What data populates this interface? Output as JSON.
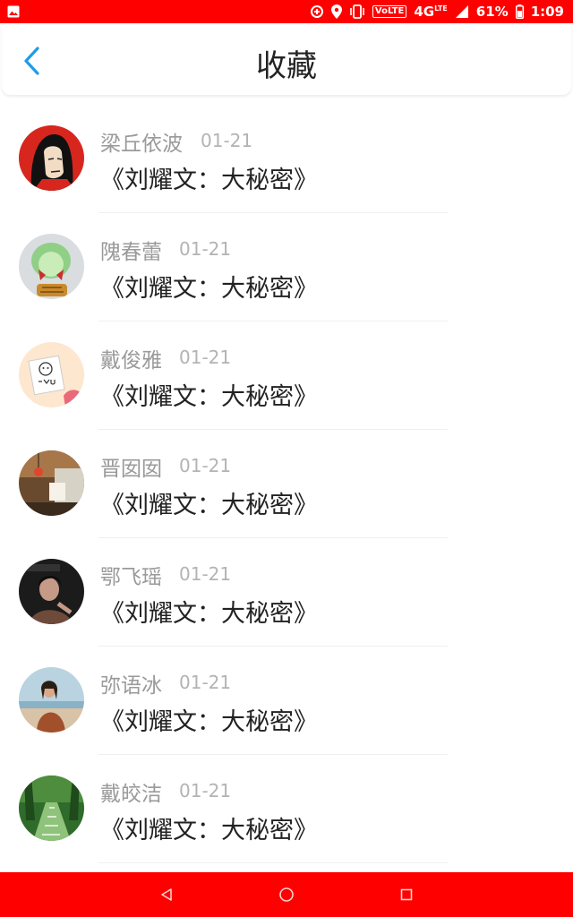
{
  "status_bar": {
    "network": "4G",
    "network_sup": "LTE",
    "volte": "VoLTE",
    "battery": "61%",
    "time": "1:09"
  },
  "header": {
    "title": "收藏"
  },
  "items": [
    {
      "name": "梁丘依波",
      "date": "01-21",
      "book": "《刘耀文：大秘密》",
      "avatar": "cartoon-woman-avatar"
    },
    {
      "name": "隗春蕾",
      "date": "01-21",
      "book": "《刘耀文：大秘密》",
      "avatar": "cabbage-avatar"
    },
    {
      "name": "戴俊雅",
      "date": "01-21",
      "book": "《刘耀文：大秘密》",
      "avatar": "bear-i-love-u-avatar"
    },
    {
      "name": "晋囡囡",
      "date": "01-21",
      "book": "《刘耀文：大秘密》",
      "avatar": "room-lantern-avatar"
    },
    {
      "name": "鄂飞瑶",
      "date": "01-21",
      "book": "《刘耀文：大秘密》",
      "avatar": "dark-portrait-avatar"
    },
    {
      "name": "弥语冰",
      "date": "01-21",
      "book": "《刘耀文：大秘密》",
      "avatar": "beach-portrait-avatar"
    },
    {
      "name": "戴皎洁",
      "date": "01-21",
      "book": "《刘耀文：大秘密》",
      "avatar": "garden-path-avatar"
    }
  ],
  "colors": {
    "status_bar_bg": "#ff0000",
    "nav_bar_bg": "#ff0000",
    "back_arrow": "#1e9be8",
    "title": "#222222",
    "name": "#9a9a9a",
    "date": "#b3b3b3",
    "book": "#222222"
  }
}
